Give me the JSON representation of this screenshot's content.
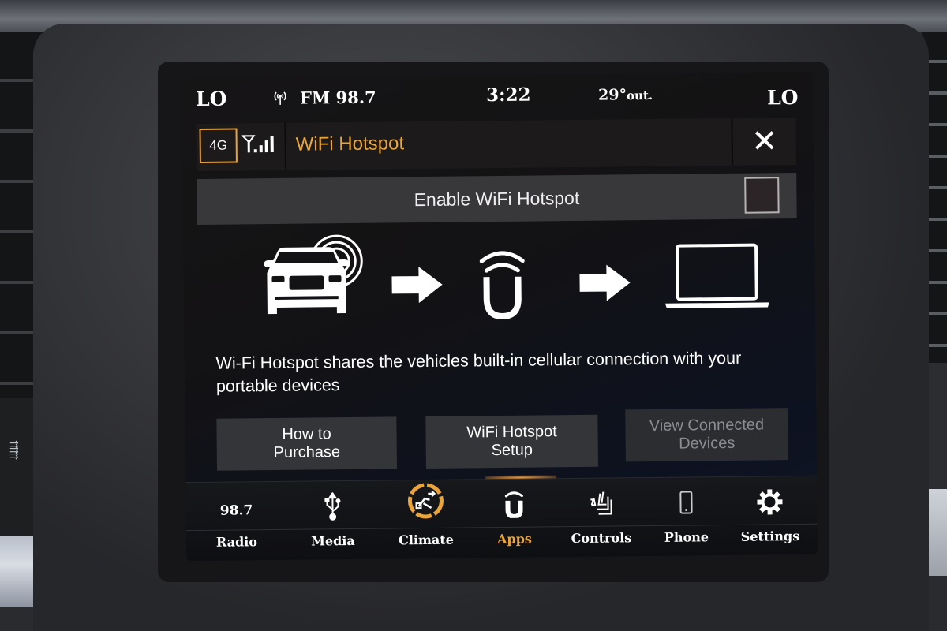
{
  "status_bar": {
    "climate_left": "LO",
    "radio_icon": "radio-antenna-icon",
    "station": "FM 98.7",
    "time": "3:22",
    "temperature": "29°",
    "temperature_suffix": "out.",
    "climate_right": "LO"
  },
  "title_bar": {
    "network_type": "4G",
    "signal_icon": "cellular-signal-icon",
    "title": "WiFi Hotspot",
    "close_symbol": "✕"
  },
  "enable_row": {
    "label": "Enable WiFi Hotspot",
    "checked": false
  },
  "diagram": {
    "steps": [
      "car-broadcasting-icon",
      "arrow-right-icon",
      "uconnect-hotspot-icon",
      "arrow-right-icon",
      "laptop-icon"
    ]
  },
  "description": "Wi-Fi Hotspot shares the vehicles built-in cellular connection with your portable devices",
  "actions": [
    {
      "label_line1": "How to",
      "label_line2": "Purchase",
      "enabled": true
    },
    {
      "label_line1": "WiFi Hotspot",
      "label_line2": "Setup",
      "enabled": true
    },
    {
      "label_line1": "View Connected",
      "label_line2": "Devices",
      "enabled": false
    }
  ],
  "nav": {
    "items": [
      {
        "label": "Radio",
        "icon_text": "98.7",
        "icon": "radio-frequency-text"
      },
      {
        "label": "Media",
        "icon": "usb-icon"
      },
      {
        "label": "Climate",
        "icon": "climate-icon"
      },
      {
        "label": "Apps",
        "icon": "uconnect-apps-icon",
        "active": true
      },
      {
        "label": "Controls",
        "icon": "seat-controls-icon"
      },
      {
        "label": "Phone",
        "icon": "phone-icon"
      },
      {
        "label": "Settings",
        "icon": "gear-icon"
      }
    ]
  },
  "colors": {
    "accent": "#eaa53a",
    "screen_bg": "#131214",
    "disabled_text": "#8a8c91"
  }
}
